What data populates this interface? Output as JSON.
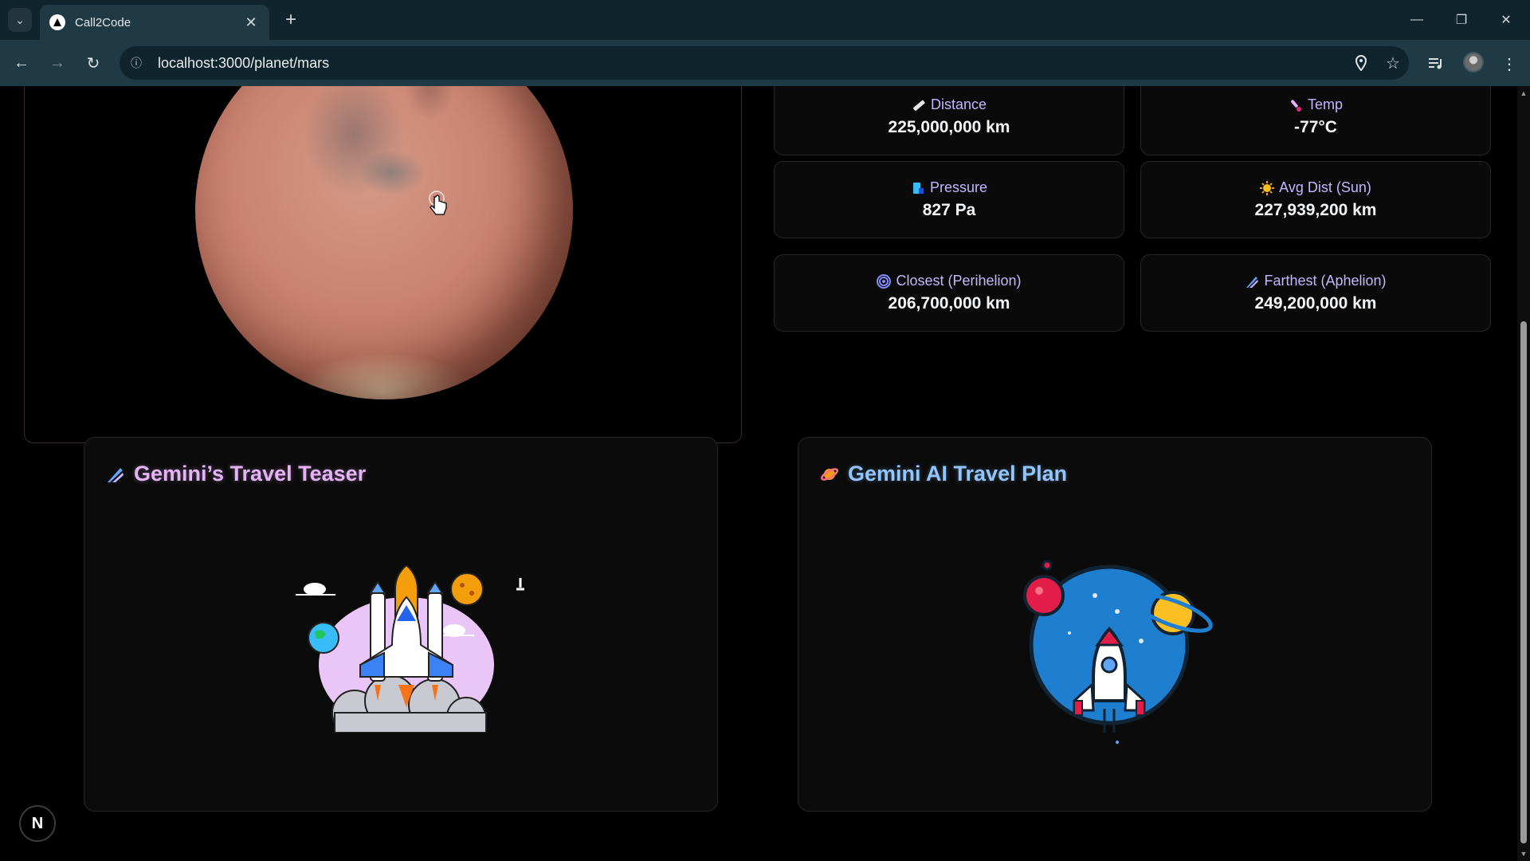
{
  "browser": {
    "tab_title": "Call2Code",
    "url": "localhost:3000/planet/mars"
  },
  "stats": [
    {
      "icon": "ruler-icon",
      "label": "Distance",
      "value": "225,000,000 km"
    },
    {
      "icon": "thermometer-icon",
      "label": "Temp",
      "value": "-77°C"
    },
    {
      "icon": "gauge-icon",
      "label": "Pressure",
      "value": "827 Pa"
    },
    {
      "icon": "sun-icon",
      "label": "Avg Dist (Sun)",
      "value": "227,939,200 km"
    },
    {
      "icon": "spiral-icon",
      "label": "Closest (Perihelion)",
      "value": "206,700,000 km"
    },
    {
      "icon": "comet-icon",
      "label": "Farthest (Aphelion)",
      "value": "249,200,000 km"
    }
  ],
  "teaser": {
    "icon": "comet-icon",
    "title": "Gemini’s Travel Teaser"
  },
  "plan": {
    "icon": "planet-icon",
    "title": "Gemini AI Travel Plan"
  },
  "colors": {
    "label": "#c4b5fd",
    "teaser_title": "#e5b3f5",
    "plan_title": "#93c5fd",
    "background": "#000000"
  }
}
